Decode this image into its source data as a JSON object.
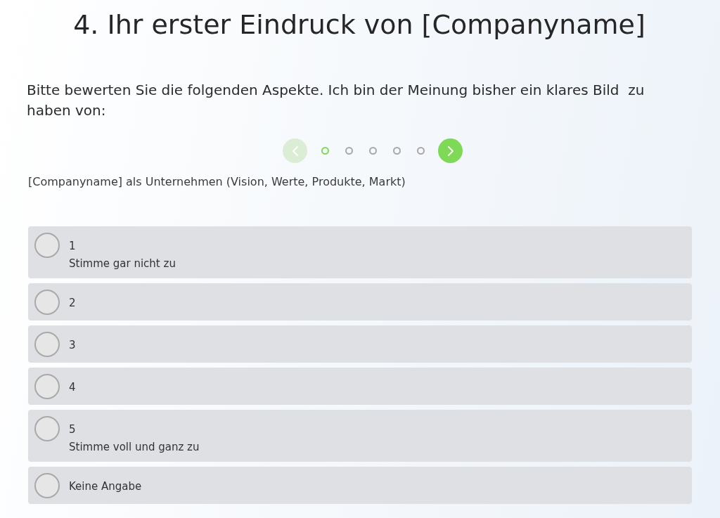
{
  "title": "4. Ihr erster Eindruck von [Companyname]",
  "instruction": "Bitte bewerten Sie die folgenden Aspekte. Ich bin der Meinung bisher ein klares Bild  zu haben von:",
  "pager": {
    "prev": {
      "disabled": true
    },
    "pages": [
      {
        "selected": true
      },
      {
        "selected": false
      },
      {
        "selected": false
      },
      {
        "selected": false
      },
      {
        "selected": false
      }
    ],
    "next": {
      "disabled": false
    }
  },
  "statement": "[Companyname] als Unternehmen (Vision, Werte, Produkte, Markt)",
  "options": [
    {
      "label": "1",
      "caption": "Stimme gar nicht zu",
      "selected": false
    },
    {
      "label": "2",
      "selected": false
    },
    {
      "label": "3",
      "selected": false
    },
    {
      "label": "4",
      "selected": false
    },
    {
      "label": "5",
      "caption": "Stimme voll und ganz zu",
      "selected": false
    },
    {
      "label": "Keine Angabe",
      "selected": false
    }
  ]
}
